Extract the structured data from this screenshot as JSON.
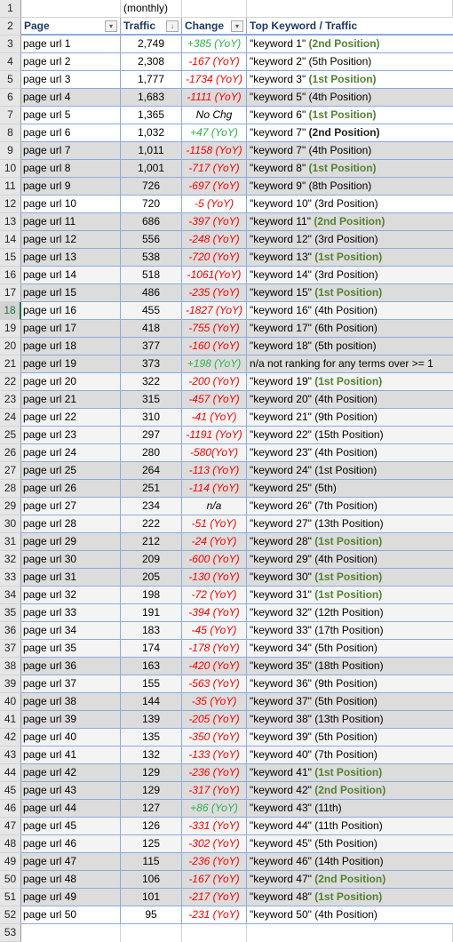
{
  "sheet": {
    "row1": {
      "row_num": "1",
      "traffic_note": "(monthly)"
    },
    "headers": {
      "row_num": "2",
      "page": "Page",
      "traffic": "Traffic",
      "change": "Change",
      "keyword": "Top Keyword / Traffic",
      "page_filter_icon": "▾",
      "traffic_sort_icon": "↓",
      "change_filter_icon": "▾"
    },
    "rows": [
      {
        "n": "3",
        "page": "page url 1",
        "traffic": "2,749",
        "change": "+385 (YoY)",
        "change_type": "pos",
        "kw": "\"keyword 1\" ",
        "rank": "(2nd Position)",
        "rank_style": "green",
        "shade": "w"
      },
      {
        "n": "4",
        "page": "page url 2",
        "traffic": "2,308",
        "change": "-167 (YoY)",
        "change_type": "neg",
        "kw": "\"keyword 2\" (5th Position)",
        "rank": "",
        "rank_style": "",
        "shade": "w"
      },
      {
        "n": "5",
        "page": "page url 3",
        "traffic": "1,777",
        "change": "-1734 (YoY)",
        "change_type": "neg",
        "kw": "\"keyword 3\" ",
        "rank": "(1st Position)",
        "rank_style": "green",
        "shade": "w"
      },
      {
        "n": "6",
        "page": "page url 4",
        "traffic": "1,683",
        "change": "-1111 (YoY)",
        "change_type": "neg",
        "kw": "\"keyword 5\" (4th Position)",
        "rank": "",
        "rank_style": "",
        "shade": "g"
      },
      {
        "n": "7",
        "page": "page url 5",
        "traffic": "1,365",
        "change": "No Chg",
        "change_type": "neu",
        "kw": "\"keyword 6\" ",
        "rank": "(1st Position)",
        "rank_style": "green",
        "shade": "w"
      },
      {
        "n": "8",
        "page": "page url 6",
        "traffic": "1,032",
        "change": "+47 (YoY)",
        "change_type": "pos",
        "kw": "\"keyword 7\" ",
        "rank": "(2nd Position)",
        "rank_style": "dark",
        "shade": "w"
      },
      {
        "n": "9",
        "page": "page url 7",
        "traffic": "1,011",
        "change": "-1158 (YoY)",
        "change_type": "neg",
        "kw": "\"keyword 7\" (4th Position)",
        "rank": "",
        "rank_style": "",
        "shade": "g"
      },
      {
        "n": "10",
        "page": "page url 8",
        "traffic": "1,001",
        "change": "-717 (YoY)",
        "change_type": "neg",
        "kw": "\"keyword 8\" ",
        "rank": "(1st Position)",
        "rank_style": "green",
        "shade": "g"
      },
      {
        "n": "11",
        "page": "page url 9",
        "traffic": "726",
        "change": "-697 (YoY)",
        "change_type": "neg",
        "kw": "\"keyword 9\" (8th Position)",
        "rank": "",
        "rank_style": "",
        "shade": "g"
      },
      {
        "n": "12",
        "page": "page url 10",
        "traffic": "720",
        "change": "-5 (YoY)",
        "change_type": "neg",
        "kw": "\"keyword 10\" (3rd Position)",
        "rank": "",
        "rank_style": "",
        "shade": "w"
      },
      {
        "n": "13",
        "page": "page url 11",
        "traffic": "686",
        "change": "-397 (YoY)",
        "change_type": "neg",
        "kw": "\"keyword 11\" ",
        "rank": "(2nd Position)",
        "rank_style": "green",
        "shade": "g"
      },
      {
        "n": "14",
        "page": "page url 12",
        "traffic": "556",
        "change": "-248 (YoY)",
        "change_type": "neg",
        "kw": "\"keyword 12\" (3rd Position)",
        "rank": "",
        "rank_style": "",
        "shade": "g"
      },
      {
        "n": "15",
        "page": "page url 13",
        "traffic": "538",
        "change": "-720 (YoY)",
        "change_type": "neg",
        "kw": "\"keyword 13\" ",
        "rank": "(1st Position)",
        "rank_style": "green",
        "shade": "g"
      },
      {
        "n": "16",
        "page": "page url 14",
        "traffic": "518",
        "change": "-1061(YoY)",
        "change_type": "neg",
        "kw": "\"keyword 14\" (3rd Position)",
        "rank": "",
        "rank_style": "",
        "shade": "l"
      },
      {
        "n": "17",
        "page": "page url 15",
        "traffic": "486",
        "change": "-235 (YoY)",
        "change_type": "neg",
        "kw": "\"keyword 15\" ",
        "rank": "(1st Position)",
        "rank_style": "green",
        "shade": "g"
      },
      {
        "n": "18",
        "page": "page url 16",
        "traffic": "455",
        "change": "-1827 (YoY)",
        "change_type": "neg",
        "kw": "\"keyword 16\" (4th Position)",
        "rank": "",
        "rank_style": "",
        "shade": "l",
        "selected": true
      },
      {
        "n": "19",
        "page": "page url 17",
        "traffic": "418",
        "change": "-755 (YoY)",
        "change_type": "neg",
        "kw": "\"keyword 17\" (6th Position)",
        "rank": "",
        "rank_style": "",
        "shade": "g"
      },
      {
        "n": "20",
        "page": "page url 18",
        "traffic": "377",
        "change": "-160 (YoY)",
        "change_type": "neg",
        "kw": "\"keyword 18\" (5th position)",
        "rank": "",
        "rank_style": "",
        "shade": "g"
      },
      {
        "n": "21",
        "page": "page url 19",
        "traffic": "373",
        "change": "+198 (YoY)",
        "change_type": "pos",
        "kw": "n/a not ranking for any terms over >= 1",
        "rank": "",
        "rank_style": "",
        "shade": "g"
      },
      {
        "n": "22",
        "page": "page url 20",
        "traffic": "322",
        "change": "-200 (YoY)",
        "change_type": "neg",
        "kw": "\"keyword 19\" ",
        "rank": "(1st Position)",
        "rank_style": "green",
        "shade": "l"
      },
      {
        "n": "23",
        "page": "page url 21",
        "traffic": "315",
        "change": "-457 (YoY)",
        "change_type": "neg",
        "kw": "\"keyword 20\" (4th Position)",
        "rank": "",
        "rank_style": "",
        "shade": "g"
      },
      {
        "n": "24",
        "page": "page url 22",
        "traffic": "310",
        "change": "-41 (YoY)",
        "change_type": "neg",
        "kw": "\"keyword 21\" (9th Position)",
        "rank": "",
        "rank_style": "",
        "shade": "l"
      },
      {
        "n": "25",
        "page": "page url 23",
        "traffic": "297",
        "change": "-1191 (YoY)",
        "change_type": "neg",
        "kw": "\"keyword 22\" (15th Position)",
        "rank": "",
        "rank_style": "",
        "shade": "l"
      },
      {
        "n": "26",
        "page": "page url 24",
        "traffic": "280",
        "change": "-580(YoY)",
        "change_type": "neg",
        "kw": "\"keyword 23\" (4th Position)",
        "rank": "",
        "rank_style": "",
        "shade": "l"
      },
      {
        "n": "27",
        "page": "page url 25",
        "traffic": "264",
        "change": "-113 (YoY)",
        "change_type": "neg",
        "kw": "\"keyword 24\" (1st Position)",
        "rank": "",
        "rank_style": "",
        "shade": "g"
      },
      {
        "n": "28",
        "page": "page url 26",
        "traffic": "251",
        "change": "-114 (YoY)",
        "change_type": "neg",
        "kw": "\"keyword 25\" (5th)",
        "rank": "",
        "rank_style": "",
        "shade": "g"
      },
      {
        "n": "29",
        "page": "page url 27",
        "traffic": "234",
        "change": "n/a",
        "change_type": "neu",
        "kw": "\"keyword 26\" (7th Position)",
        "rank": "",
        "rank_style": "",
        "shade": "l"
      },
      {
        "n": "30",
        "page": "page url 28",
        "traffic": "222",
        "change": "-51 (YoY)",
        "change_type": "neg",
        "kw": "\"keyword 27\" (13th Position)",
        "rank": "",
        "rank_style": "",
        "shade": "l"
      },
      {
        "n": "31",
        "page": "page url 29",
        "traffic": "212",
        "change": "-24 (YoY)",
        "change_type": "neg",
        "kw": "\"keyword 28\" ",
        "rank": "(1st Position)",
        "rank_style": "green",
        "shade": "g"
      },
      {
        "n": "32",
        "page": "page url 30",
        "traffic": "209",
        "change": "-600 (YoY)",
        "change_type": "neg",
        "kw": "\"keyword 29\" (4th Position)",
        "rank": "",
        "rank_style": "",
        "shade": "g"
      },
      {
        "n": "33",
        "page": "page url 31",
        "traffic": "205",
        "change": "-130 (YoY)",
        "change_type": "neg",
        "kw": "\"keyword 30\" ",
        "rank": "(1st Position)",
        "rank_style": "green",
        "shade": "g"
      },
      {
        "n": "34",
        "page": "page url 32",
        "traffic": "198",
        "change": "-72 (YoY)",
        "change_type": "neg",
        "kw": "\"keyword 31\" ",
        "rank": "(1st Position)",
        "rank_style": "green",
        "shade": "l"
      },
      {
        "n": "35",
        "page": "page url 33",
        "traffic": "191",
        "change": "-394 (YoY)",
        "change_type": "neg",
        "kw": "\"keyword 32\" (12th Position)",
        "rank": "",
        "rank_style": "",
        "shade": "l"
      },
      {
        "n": "36",
        "page": "page url 34",
        "traffic": "183",
        "change": "-45 (YoY)",
        "change_type": "neg",
        "kw": "\"keyword 33\" (17th Position)",
        "rank": "",
        "rank_style": "",
        "shade": "l"
      },
      {
        "n": "37",
        "page": "page url 35",
        "traffic": "174",
        "change": "-178 (YoY)",
        "change_type": "neg",
        "kw": "\"keyword 34\" (5th Position)",
        "rank": "",
        "rank_style": "",
        "shade": "l"
      },
      {
        "n": "38",
        "page": "page url 36",
        "traffic": "163",
        "change": "-420 (YoY)",
        "change_type": "neg",
        "kw": "\"keyword 35\" (18th Position)",
        "rank": "",
        "rank_style": "",
        "shade": "g"
      },
      {
        "n": "39",
        "page": "page url 37",
        "traffic": "155",
        "change": "-563 (YoY)",
        "change_type": "neg",
        "kw": "\"keyword 36\" (9th Position)",
        "rank": "",
        "rank_style": "",
        "shade": "l"
      },
      {
        "n": "40",
        "page": "page url 38",
        "traffic": "144",
        "change": "-35 (YoY)",
        "change_type": "neg",
        "kw": "\"keyword 37\" (5th Position)",
        "rank": "",
        "rank_style": "",
        "shade": "g"
      },
      {
        "n": "41",
        "page": "page url 39",
        "traffic": "139",
        "change": "-205 (YoY)",
        "change_type": "neg",
        "kw": "\"keyword 38\" (13th Position)",
        "rank": "",
        "rank_style": "",
        "shade": "g"
      },
      {
        "n": "42",
        "page": "page url 40",
        "traffic": "135",
        "change": "-350 (YoY)",
        "change_type": "neg",
        "kw": "\"keyword 39\" (5th Position)",
        "rank": "",
        "rank_style": "",
        "shade": "l"
      },
      {
        "n": "43",
        "page": "page url 41",
        "traffic": "132",
        "change": "-133 (YoY)",
        "change_type": "neg",
        "kw": "\"keyword 40\" (7th Position)",
        "rank": "",
        "rank_style": "",
        "shade": "l"
      },
      {
        "n": "44",
        "page": "page url 42",
        "traffic": "129",
        "change": "-236 (YoY)",
        "change_type": "neg",
        "kw": "\"keyword 41\" ",
        "rank": "(1st Position)",
        "rank_style": "green",
        "shade": "g"
      },
      {
        "n": "45",
        "page": "page url 43",
        "traffic": "129",
        "change": "-317 (YoY)",
        "change_type": "neg",
        "kw": "\"keyword 42\" ",
        "rank": "(2nd Position)",
        "rank_style": "green",
        "shade": "g"
      },
      {
        "n": "46",
        "page": "page url 44",
        "traffic": "127",
        "change": "+86 (YoY)",
        "change_type": "pos",
        "kw": "\"keyword 43\" (11th)",
        "rank": "",
        "rank_style": "",
        "shade": "g"
      },
      {
        "n": "47",
        "page": "page url 45",
        "traffic": "126",
        "change": "-331 (YoY)",
        "change_type": "neg",
        "kw": "\"keyword 44\" (11th Position)",
        "rank": "",
        "rank_style": "",
        "shade": "l"
      },
      {
        "n": "48",
        "page": "page url 46",
        "traffic": "125",
        "change": "-302 (YoY)",
        "change_type": "neg",
        "kw": "\"keyword 45\" (5th Position)",
        "rank": "",
        "rank_style": "",
        "shade": "l"
      },
      {
        "n": "49",
        "page": "page url 47",
        "traffic": "115",
        "change": "-236 (YoY)",
        "change_type": "neg",
        "kw": "\"keyword 46\" (14th Position)",
        "rank": "",
        "rank_style": "",
        "shade": "g"
      },
      {
        "n": "50",
        "page": "page url 48",
        "traffic": "106",
        "change": "-167 (YoY)",
        "change_type": "neg",
        "kw": "\"keyword 47\" ",
        "rank": "(2nd Position)",
        "rank_style": "green",
        "shade": "g"
      },
      {
        "n": "51",
        "page": "page url 49",
        "traffic": "101",
        "change": "-217 (YoY)",
        "change_type": "neg",
        "kw": "\"keyword 48\" ",
        "rank": "(1st Position)",
        "rank_style": "green",
        "shade": "g"
      },
      {
        "n": "52",
        "page": "page url 50",
        "traffic": "95",
        "change": "-231 (YoY)",
        "change_type": "neg",
        "kw": "\"keyword 50\" (4th Position)",
        "rank": "",
        "rank_style": "",
        "shade": "w"
      }
    ],
    "trailing_row_num": "53"
  },
  "colors": {
    "positive": "#2bb24c",
    "negative": "#ff0000",
    "rank_highlight": "#548235",
    "header_text": "#1f3864",
    "grid_border": "#8eaadb",
    "shade_gray": "#dcdcdc",
    "shade_light": "#f4f4f4"
  }
}
